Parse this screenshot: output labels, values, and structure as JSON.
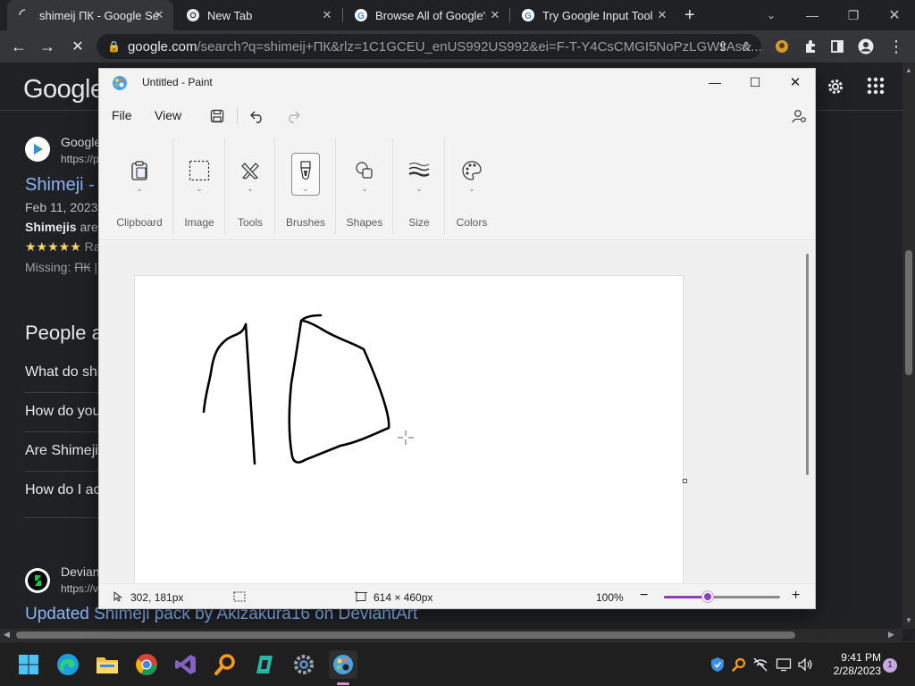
{
  "browser": {
    "tabs": [
      {
        "title": "shimeij ПК - Google Se"
      },
      {
        "title": "New Tab"
      },
      {
        "title": "Browse All of Google's"
      },
      {
        "title": "Try Google Input Tools"
      }
    ],
    "new_tab_label": "+",
    "url_host": "google.com",
    "url_path": "/search?q=shimeij+ПК&rlz=1C1GCEU_enUS992US992&ei=F-T-Y4CsCMGI5NoPzLGWsAs&..."
  },
  "google_page": {
    "logo": "Google",
    "result1": {
      "source": "Google",
      "url": "https://p",
      "title": "Shimeji -",
      "date": "Feb 11, 2023",
      "snippet_bold": "Shimejis",
      "snippet": "are",
      "rating_stars": "★★★★★",
      "rating_text": "Ra",
      "missing_label": "Missing:",
      "missing_term": "ПК",
      "missing_tail": "|"
    },
    "paa_heading": "People a",
    "questions": [
      "What do shi",
      "How do you",
      "Are Shimeji",
      "How do I ac"
    ],
    "result2": {
      "source": "Devian",
      "url": "https://v",
      "title": "Updated Shimeji pack by Akizakura16 on DeviantArt"
    }
  },
  "paint": {
    "title": "Untitled - Paint",
    "menu": {
      "file": "File",
      "view": "View"
    },
    "ribbon": {
      "clipboard": "Clipboard",
      "image": "Image",
      "tools": "Tools",
      "brushes": "Brushes",
      "shapes": "Shapes",
      "size": "Size",
      "colors": "Colors"
    },
    "status": {
      "cursor_pos": "302, 181px",
      "canvas_size": "614 × 460px",
      "zoom": "100%",
      "zoom_level": 0.38
    },
    "accent_color": "#8e3fb8"
  },
  "taskbar": {
    "time": "9:41 PM",
    "date": "2/28/2023",
    "notification_count": "1"
  }
}
